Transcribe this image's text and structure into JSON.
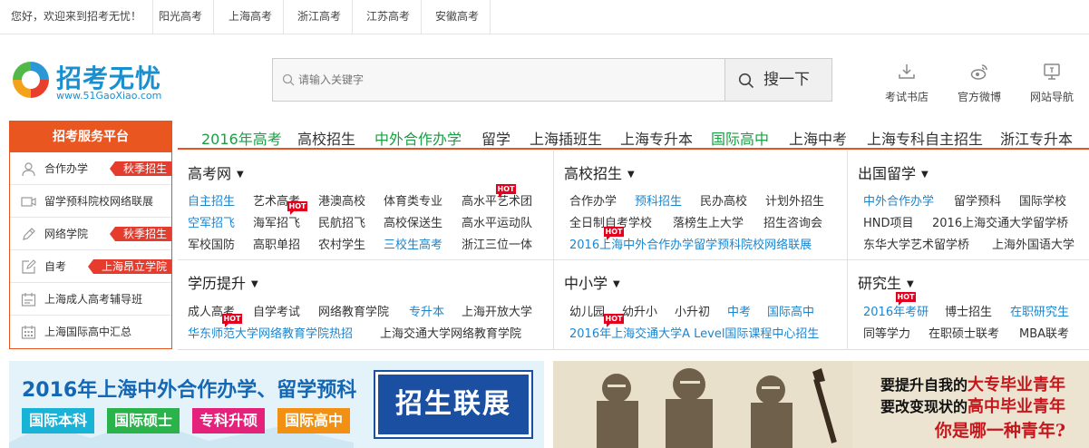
{
  "topbar": {
    "welcome": "您好，欢迎来到招考无忧！",
    "links": [
      "阳光高考",
      "上海高考",
      "浙江高考",
      "江苏高考",
      "安徽高考"
    ]
  },
  "logo": {
    "name": "招考无忧",
    "url_text": "www.51GaoXiao.com"
  },
  "search": {
    "placeholder": "请输入关键字",
    "button": "搜一下"
  },
  "quick_links": [
    {
      "label": "考试书店",
      "icon": "download-icon"
    },
    {
      "label": "官方微博",
      "icon": "weibo-icon"
    },
    {
      "label": "网站导航",
      "icon": "monitor-icon"
    }
  ],
  "service_panel": {
    "title": "招考服务平台",
    "items": [
      {
        "label": "合作办学",
        "badge": "秋季招生",
        "icon": "user-icon"
      },
      {
        "label": "留学预科院校网络联展",
        "badge": "",
        "icon": "video-icon"
      },
      {
        "label": "网络学院",
        "badge": "秋季招生",
        "icon": "pencil-icon"
      },
      {
        "label": "自考",
        "badge": "上海昂立学院",
        "icon": "edit-icon"
      },
      {
        "label": "上海成人高考辅导班",
        "badge": "",
        "icon": "calendar-icon"
      },
      {
        "label": "上海国际高中汇总",
        "badge": "",
        "icon": "grid-calendar-icon"
      }
    ]
  },
  "nav": [
    "2016年高考",
    "高校招生",
    "中外合作办学",
    "留学",
    "上海插班生",
    "上海专升本",
    "国际高中",
    "上海中考",
    "上海专科自主招生",
    "浙江专升本"
  ],
  "hot_label": "HOT",
  "sections": {
    "gaokao": {
      "title": "高考网",
      "rows": [
        [
          "自主招生",
          "艺术高考",
          "港澳高校",
          "体育类专业",
          "高水平艺术团"
        ],
        [
          "空军招飞",
          "海军招飞",
          "民航招飞",
          "高校保送生",
          "高水平运动队"
        ],
        [
          "军校国防",
          "高职单招",
          "农村学生",
          "三校生高考",
          "浙江三位一体"
        ]
      ]
    },
    "gaoxiao": {
      "title": "高校招生",
      "rows": [
        [
          "合作办学",
          "预科招生",
          "民办高校",
          "计划外招生"
        ],
        [
          "全日制自考学校",
          "落榜生上大学",
          "招生咨询会"
        ],
        [
          "2016上海中外合作办学留学预科院校网络联展"
        ]
      ]
    },
    "liuxue": {
      "title": "出国留学",
      "rows": [
        [
          "中外合作办学",
          "留学预科",
          "国际学校"
        ],
        [
          "HND项目",
          "2016上海交通大学留学桥"
        ],
        [
          "东华大学艺术留学桥",
          "上海外国语大学"
        ]
      ]
    },
    "xueli": {
      "title": "学历提升",
      "rows": [
        [
          "成人高考",
          "自学考试",
          "网络教育学院",
          "专升本",
          "上海开放大学"
        ],
        [
          "华东师范大学网络教育学院热招",
          "上海交通大学网络教育学院"
        ]
      ]
    },
    "zhongxiao": {
      "title": "中小学",
      "rows": [
        [
          "幼儿园",
          "幼升小",
          "小升初",
          "中考",
          "国际高中"
        ],
        [
          "2016年上海交通大学A Level国际课程中心招生"
        ]
      ]
    },
    "yanjiu": {
      "title": "研究生",
      "rows": [
        [
          "2016年考研",
          "博士招生",
          "在职研究生"
        ],
        [
          "同等学力",
          "在职硕士联考",
          "MBA联考"
        ]
      ]
    }
  },
  "banner_left": {
    "title": "2016年上海中外合作办学、留学预科",
    "tags": [
      {
        "label": "国际本科",
        "color": "#19b3d8"
      },
      {
        "label": "国际硕士",
        "color": "#29b34a"
      },
      {
        "label": "专科升硕",
        "color": "#e5227b"
      },
      {
        "label": "国际高中",
        "color": "#f29014"
      }
    ],
    "button": "招生联展"
  },
  "banner_right": {
    "line1_pre": "要提升自我的",
    "line1_red": "大专毕业青年",
    "line2_pre": "要改变现状的",
    "line2_red": "高中毕业青年",
    "line3": "你是哪一种青年?"
  },
  "colors": {
    "brand_blue": "#1a8fd0",
    "accent_orange": "#ea5620",
    "link_blue": "#1a86d0",
    "nav_green": "#19a045",
    "hot_red": "#e4001d"
  }
}
